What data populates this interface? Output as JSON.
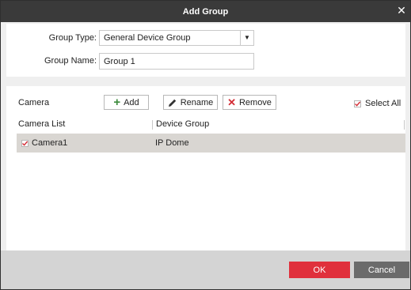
{
  "dialog": {
    "title": "Add Group",
    "close_icon": "close-icon"
  },
  "form": {
    "group_type_label": "Group Type:",
    "group_type_value": "General Device Group",
    "group_name_label": "Group Name:",
    "group_name_value": "Group 1"
  },
  "camera": {
    "section_label": "Camera",
    "buttons": {
      "add": "Add",
      "rename": "Rename",
      "remove": "Remove"
    },
    "select_all_label": "Select All",
    "select_all_checked": true,
    "columns": [
      "Camera List",
      "Device Group"
    ],
    "rows": [
      {
        "checked": true,
        "name": "Camera1",
        "device_group": "IP Dome"
      }
    ]
  },
  "footer": {
    "ok_label": "OK",
    "cancel_label": "Cancel"
  },
  "colors": {
    "titlebar": "#3a3a3a",
    "ok": "#e0303c",
    "cancel": "#6b6b6b",
    "selected_row": "#d9d6d2",
    "check": "#d32c35"
  }
}
